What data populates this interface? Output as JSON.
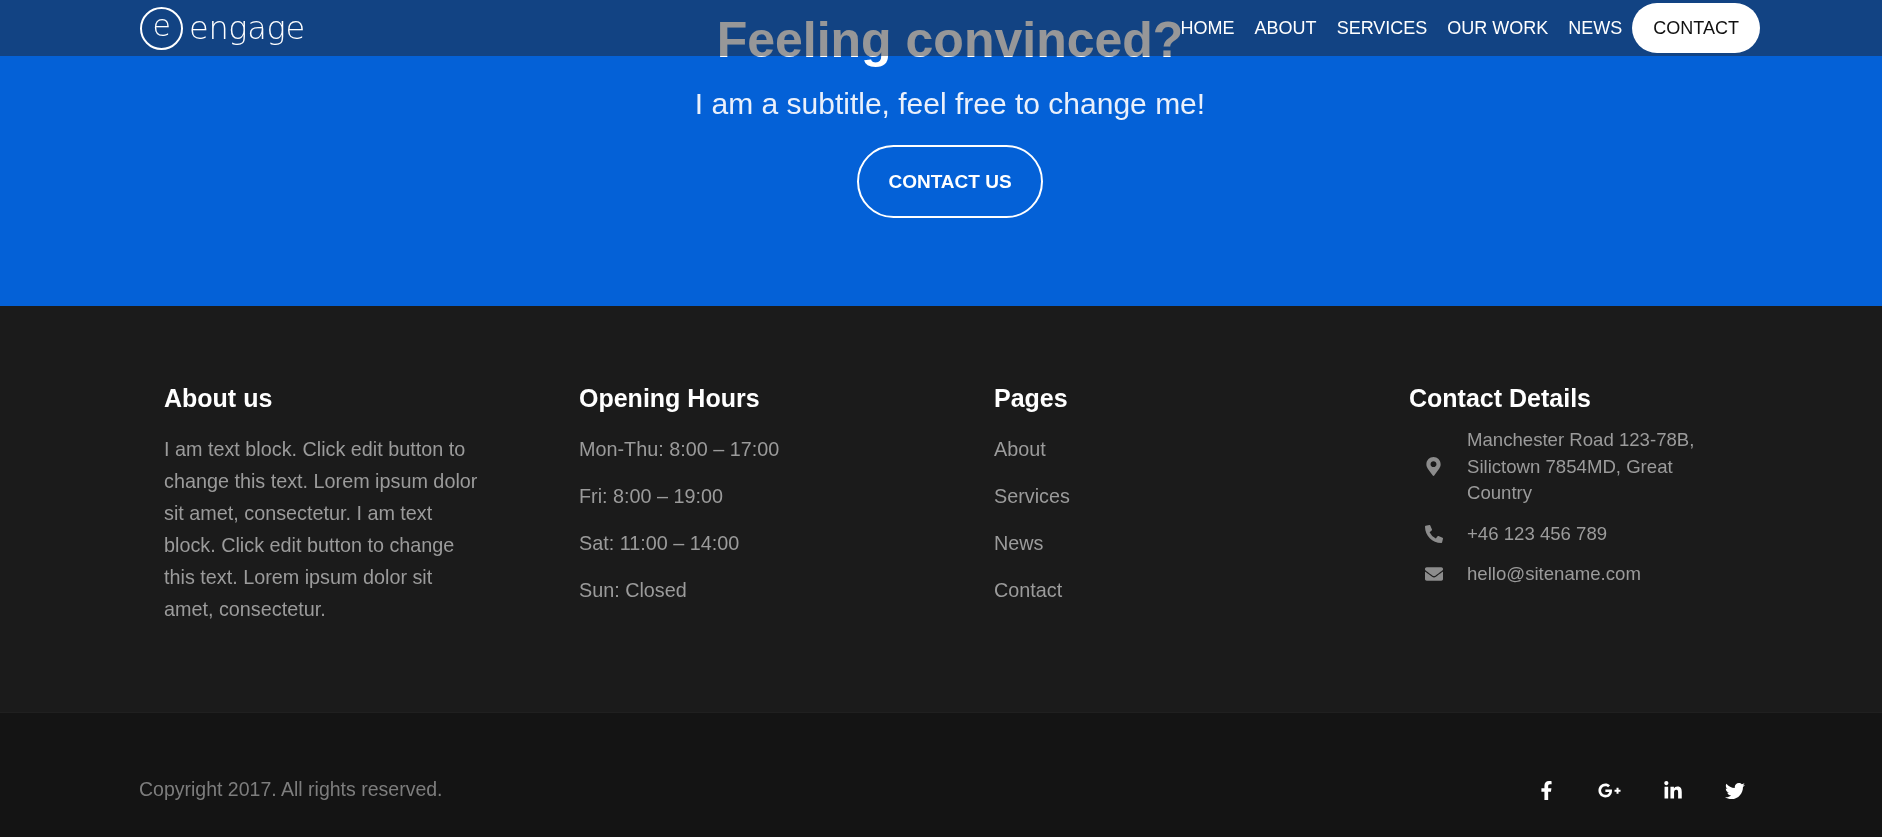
{
  "header": {
    "logo": {
      "mark": "e",
      "name": "engage"
    },
    "nav": [
      {
        "label": "HOME",
        "kind": "link"
      },
      {
        "label": "ABOUT",
        "kind": "link"
      },
      {
        "label": "SERVICES",
        "kind": "link"
      },
      {
        "label": "OUR WORK",
        "kind": "link"
      },
      {
        "label": "NEWS",
        "kind": "link"
      },
      {
        "label": "CONTACT",
        "kind": "button"
      }
    ]
  },
  "hero": {
    "title": "Feeling convinced?",
    "subtitle": "I am a subtitle, feel free to change me!",
    "button": "CONTACT US"
  },
  "footer": {
    "columns": [
      {
        "kind": "text",
        "heading": "About us",
        "text": "I am text block. Click edit button to change this text. Lorem ipsum dolor sit amet, consectetur. I am text block. Click edit button to change this text. Lorem ipsum dolor sit amet, consectetur."
      },
      {
        "kind": "hours",
        "heading": "Opening Hours",
        "items": [
          "Mon-Thu: 8:00 – 17:00",
          "Fri: 8:00 – 19:00",
          "Sat: 11:00 – 14:00",
          "Sun: Closed"
        ]
      },
      {
        "kind": "links",
        "heading": "Pages",
        "items": [
          "About",
          "Services",
          "News",
          "Contact"
        ]
      },
      {
        "kind": "contacts",
        "heading": "Contact Details",
        "items": [
          {
            "kind": "address",
            "text": "Manchester Road 123-78B, Silictown 7854MD, Great Country"
          },
          {
            "kind": "phone",
            "text": "+46 123 456 789"
          },
          {
            "kind": "email",
            "text": "hello@sitename.com"
          }
        ]
      }
    ]
  },
  "bottom_bar": {
    "copyright": "Copyright 2017. All rights reserved.",
    "social": [
      {
        "kind": "facebook"
      },
      {
        "kind": "google-plus"
      },
      {
        "kind": "linkedin"
      },
      {
        "kind": "twitter"
      }
    ]
  }
}
